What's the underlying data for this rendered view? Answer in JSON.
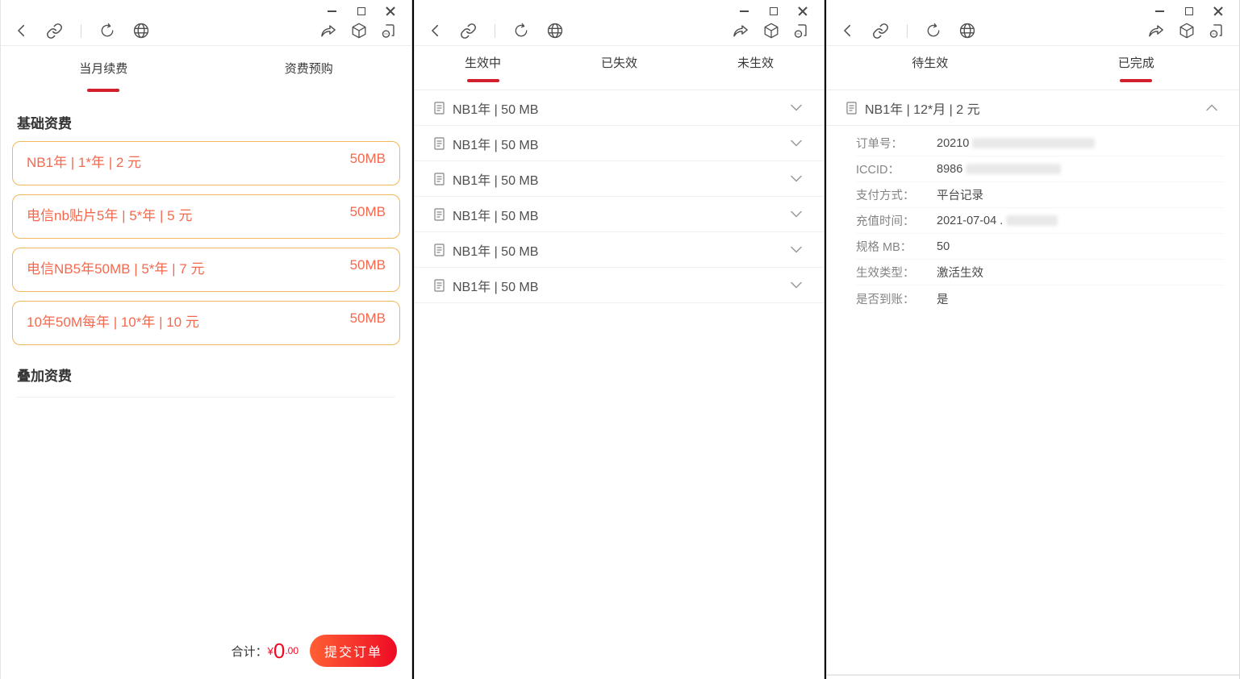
{
  "colors": {
    "tab_underline_red": "#d2202f",
    "price_red": "#ee0a24",
    "plan_text_orange": "#f4694d",
    "card_border_gold": "#efb65e",
    "submit_gradient": [
      "#ff6034",
      "#ee0a24"
    ]
  },
  "renew": {
    "tabs": [
      "当月续费",
      "资费预购"
    ],
    "basic_section_title": "基础资费",
    "addon_section_title": "叠加资费",
    "plans": [
      {
        "title": "NB1年 | 1*年 | 2 元",
        "quota": "50MB"
      },
      {
        "title": "电信nb贴片5年 | 5*年 | 5 元",
        "quota": "50MB"
      },
      {
        "title": "电信NB5年50MB | 5*年 | 7 元",
        "quota": "50MB"
      },
      {
        "title": "10年50M每年 | 10*年 | 10 元",
        "quota": "50MB"
      }
    ],
    "footer": {
      "total_label": "合计：",
      "currency": "¥",
      "amount_int": "0",
      "amount_dec": ".00",
      "submit_label": "提交订单"
    }
  },
  "status": {
    "tabs": [
      "生效中",
      "已失效",
      "未生效"
    ],
    "items": [
      "NB1年 | 50 MB",
      "NB1年 | 50 MB",
      "NB1年 | 50 MB",
      "NB1年 | 50 MB",
      "NB1年 | 50 MB",
      "NB1年 | 50 MB"
    ]
  },
  "order": {
    "tabs": [
      "待生效",
      "已完成"
    ],
    "header_label": "NB1年 | 12*月 | 2 元",
    "details": [
      {
        "label": "订单号：",
        "value": "20210",
        "redacted": true
      },
      {
        "label": "ICCID：",
        "value": "8986",
        "redacted": true
      },
      {
        "label": "支付方式：",
        "value": "平台记录",
        "redacted": false
      },
      {
        "label": "充值时间：",
        "value": "2021-07-04 .",
        "redacted": true
      },
      {
        "label": "规格 MB：",
        "value": "50",
        "redacted": false
      },
      {
        "label": "生效类型：",
        "value": "激活生效",
        "redacted": false
      },
      {
        "label": "是否到账：",
        "value": "是",
        "redacted": false
      }
    ]
  }
}
